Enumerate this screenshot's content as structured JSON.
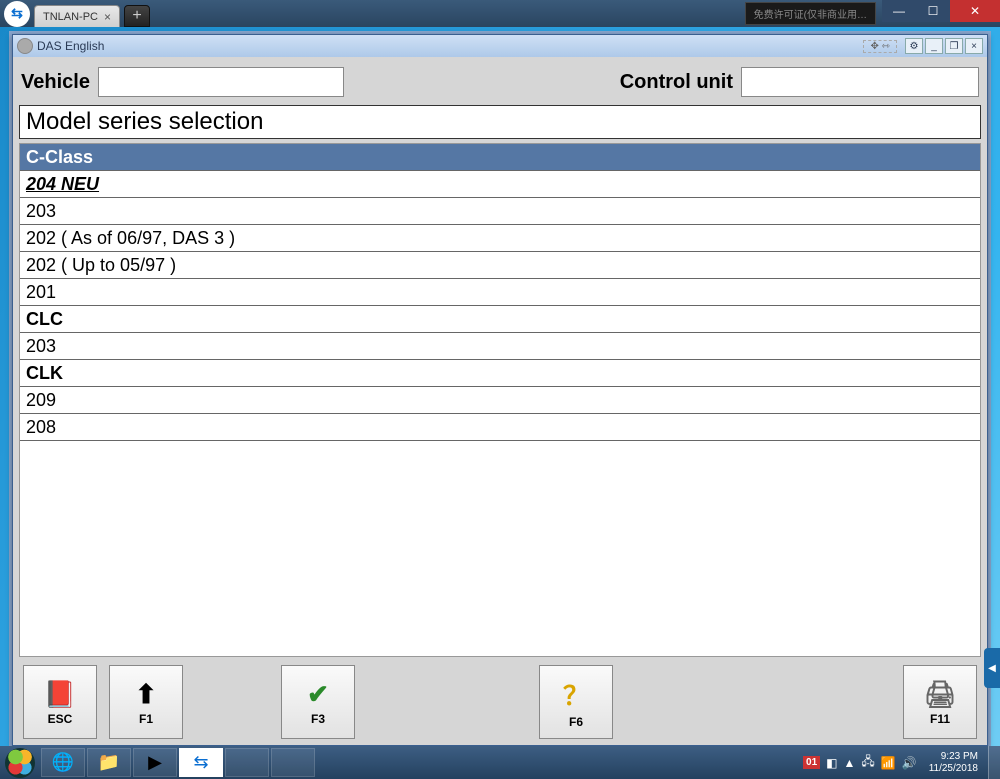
{
  "outer": {
    "tab_label": "TNLAN-PC",
    "status_text": "免费许可证(仅非商业用…"
  },
  "app": {
    "title": "DAS English",
    "move_hint": "✥ ⇿"
  },
  "header": {
    "vehicle_label": "Vehicle",
    "control_unit_label": "Control unit"
  },
  "section_title": "Model series selection",
  "rows": [
    {
      "text": "C-Class",
      "kind": "header"
    },
    {
      "text": "204 NEU",
      "kind": "selected"
    },
    {
      "text": "203",
      "kind": ""
    },
    {
      "text": "202 ( As of 06/97, DAS 3 )",
      "kind": ""
    },
    {
      "text": "202 ( Up to 05/97 )",
      "kind": ""
    },
    {
      "text": "201",
      "kind": ""
    },
    {
      "text": "CLC",
      "kind": "bold"
    },
    {
      "text": "203",
      "kind": ""
    },
    {
      "text": "CLK",
      "kind": "bold"
    },
    {
      "text": "209",
      "kind": ""
    },
    {
      "text": "208",
      "kind": ""
    }
  ],
  "fkeys": {
    "esc": "ESC",
    "f1": "F1",
    "f3": "F3",
    "f6": "F6",
    "f11": "F11"
  },
  "tray": {
    "lang": "01",
    "time": "9:23 PM",
    "date": "11/25/2018"
  }
}
